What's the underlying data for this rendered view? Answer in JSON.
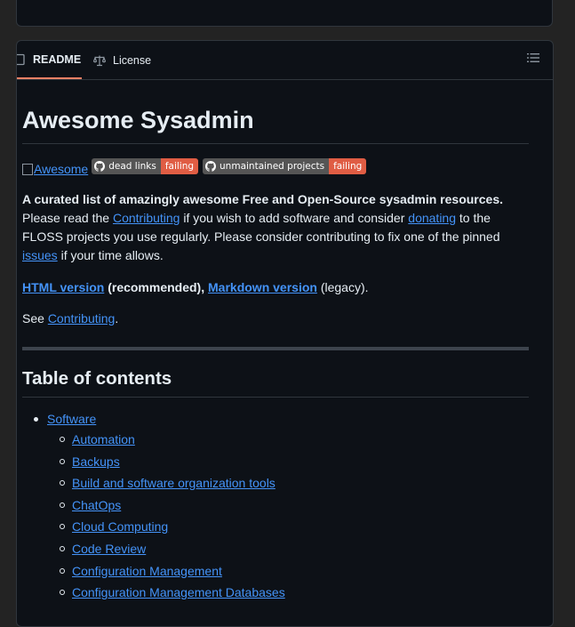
{
  "tabs": {
    "readme": "README",
    "license": "License"
  },
  "article": {
    "title": "Awesome Sysadmin",
    "awesome_alt": "Awesome",
    "badges": [
      {
        "label": "dead links",
        "status": "failing"
      },
      {
        "label": "unmaintained projects",
        "status": "failing"
      }
    ],
    "intro": {
      "bold": "A curated list of amazingly awesome Free and Open-Source sysadmin resources.",
      "t1": "Please read the ",
      "link_contributing": "Contributing",
      "t2": " if you wish to add software and consider ",
      "link_donating": "donating",
      "t3": " to the FLOSS projects you use regularly. Please consider contributing to fix one of the pinned ",
      "link_issues": "issues",
      "t4": " if your time allows."
    },
    "versions": {
      "html_link": "HTML version",
      "recommended": " (recommended), ",
      "markdown_link": "Markdown version",
      "legacy": " (legacy)."
    },
    "see": {
      "prefix": "See ",
      "link": "Contributing",
      "suffix": "."
    },
    "toc_title": "Table of contents",
    "toc": {
      "top": "Software",
      "items": [
        "Automation",
        "Backups",
        "Build and software organization tools",
        "ChatOps",
        "Cloud Computing",
        "Code Review",
        "Configuration Management",
        "Configuration Management Databases"
      ]
    }
  },
  "colors": {
    "link": "#4493f8",
    "badge_fail": "#e05d44",
    "tab_underline": "#f78166"
  }
}
